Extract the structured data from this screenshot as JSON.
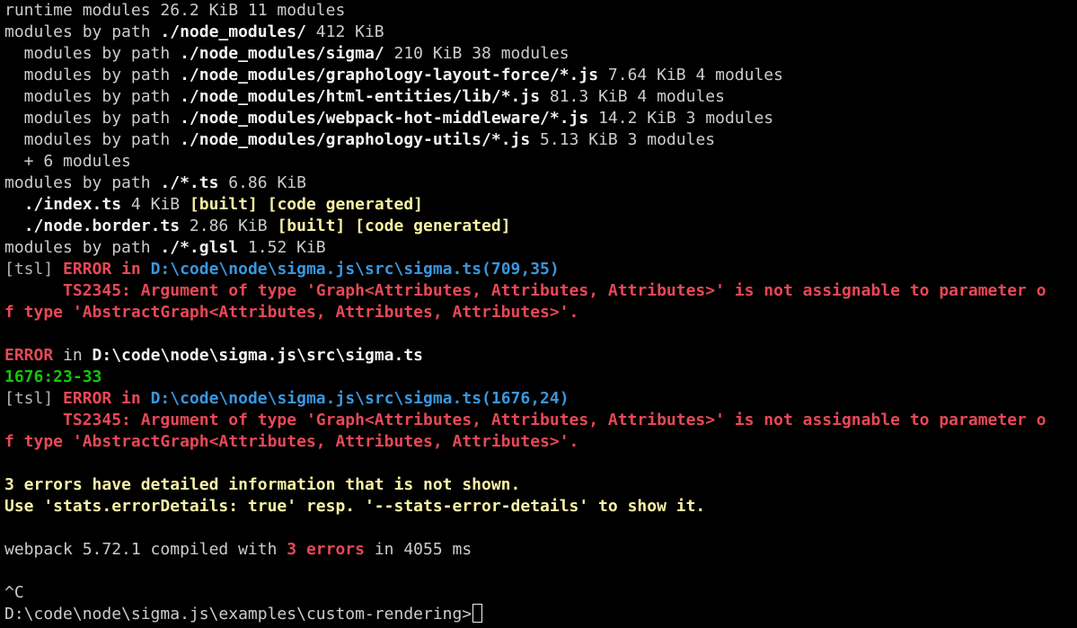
{
  "terminal": {
    "lines": [
      {
        "segments": [
          {
            "text": "runtime modules 26.2 KiB 11 modules",
            "cls": "white"
          }
        ]
      },
      {
        "segments": [
          {
            "text": "modules by path ",
            "cls": "white"
          },
          {
            "text": "./node_modules/",
            "cls": "bright b"
          },
          {
            "text": " 412 KiB",
            "cls": "white"
          }
        ]
      },
      {
        "segments": [
          {
            "text": "  modules by path ",
            "cls": "white"
          },
          {
            "text": "./node_modules/sigma/",
            "cls": "bright b"
          },
          {
            "text": " 210 KiB 38 modules",
            "cls": "white"
          }
        ]
      },
      {
        "segments": [
          {
            "text": "  modules by path ",
            "cls": "white"
          },
          {
            "text": "./node_modules/graphology-layout-force/*.js",
            "cls": "bright b"
          },
          {
            "text": " 7.64 KiB 4 modules",
            "cls": "white"
          }
        ]
      },
      {
        "segments": [
          {
            "text": "  modules by path ",
            "cls": "white"
          },
          {
            "text": "./node_modules/html-entities/lib/*.js",
            "cls": "bright b"
          },
          {
            "text": " 81.3 KiB 4 modules",
            "cls": "white"
          }
        ]
      },
      {
        "segments": [
          {
            "text": "  modules by path ",
            "cls": "white"
          },
          {
            "text": "./node_modules/webpack-hot-middleware/*.js",
            "cls": "bright b"
          },
          {
            "text": " 14.2 KiB 3 modules",
            "cls": "white"
          }
        ]
      },
      {
        "segments": [
          {
            "text": "  modules by path ",
            "cls": "white"
          },
          {
            "text": "./node_modules/graphology-utils/*.js",
            "cls": "bright b"
          },
          {
            "text": " 5.13 KiB 3 modules",
            "cls": "white"
          }
        ]
      },
      {
        "segments": [
          {
            "text": "  + 6 modules",
            "cls": "white"
          }
        ]
      },
      {
        "segments": [
          {
            "text": "modules by path ",
            "cls": "white"
          },
          {
            "text": "./*.ts",
            "cls": "bright b"
          },
          {
            "text": " 6.86 KiB",
            "cls": "white"
          }
        ]
      },
      {
        "segments": [
          {
            "text": "  ",
            "cls": "white"
          },
          {
            "text": "./index.ts",
            "cls": "bright b"
          },
          {
            "text": " 4 KiB ",
            "cls": "white"
          },
          {
            "text": "[built]",
            "cls": "yellow b"
          },
          {
            "text": " ",
            "cls": "white"
          },
          {
            "text": "[code generated]",
            "cls": "yellow b"
          }
        ]
      },
      {
        "segments": [
          {
            "text": "  ",
            "cls": "white"
          },
          {
            "text": "./node.border.ts",
            "cls": "bright b"
          },
          {
            "text": " 2.86 KiB ",
            "cls": "white"
          },
          {
            "text": "[built]",
            "cls": "yellow b"
          },
          {
            "text": " ",
            "cls": "white"
          },
          {
            "text": "[code generated]",
            "cls": "yellow b"
          }
        ]
      },
      {
        "segments": [
          {
            "text": "modules by path ",
            "cls": "white"
          },
          {
            "text": "./*.glsl",
            "cls": "bright b"
          },
          {
            "text": " 1.52 KiB",
            "cls": "white"
          }
        ]
      },
      {
        "segments": [
          {
            "text": "[tsl] ",
            "cls": "gray"
          },
          {
            "text": "ERROR",
            "cls": "red b"
          },
          {
            "text": " in ",
            "cls": "red b"
          },
          {
            "text": "D:\\code\\node\\sigma.js\\src\\sigma.ts(709,35)",
            "cls": "cyan b"
          }
        ]
      },
      {
        "segments": [
          {
            "text": "      TS2345: Argument of type 'Graph<Attributes, Attributes, Attributes>' is not assignable to parameter o",
            "cls": "red b"
          }
        ]
      },
      {
        "segments": [
          {
            "text": "f type 'AbstractGraph<Attributes, Attributes, Attributes>'.",
            "cls": "red b"
          }
        ]
      },
      {
        "segments": [
          {
            "text": "",
            "cls": "white"
          }
        ]
      },
      {
        "segments": [
          {
            "text": "ERROR",
            "cls": "red b"
          },
          {
            "text": " in ",
            "cls": "white"
          },
          {
            "text": "D:\\code\\node\\sigma.js\\src\\sigma.ts",
            "cls": "bright b"
          }
        ]
      },
      {
        "segments": [
          {
            "text": "1676:23-33",
            "cls": "green b"
          }
        ]
      },
      {
        "segments": [
          {
            "text": "[tsl] ",
            "cls": "gray"
          },
          {
            "text": "ERROR",
            "cls": "red b"
          },
          {
            "text": " in ",
            "cls": "red b"
          },
          {
            "text": "D:\\code\\node\\sigma.js\\src\\sigma.ts(1676,24)",
            "cls": "cyan b"
          }
        ]
      },
      {
        "segments": [
          {
            "text": "      TS2345: Argument of type 'Graph<Attributes, Attributes, Attributes>' is not assignable to parameter o",
            "cls": "red b"
          }
        ]
      },
      {
        "segments": [
          {
            "text": "f type 'AbstractGraph<Attributes, Attributes, Attributes>'.",
            "cls": "red b"
          }
        ]
      },
      {
        "segments": [
          {
            "text": "",
            "cls": "white"
          }
        ]
      },
      {
        "segments": [
          {
            "text": "3 errors have detailed information that is not shown.",
            "cls": "yellow b"
          }
        ]
      },
      {
        "segments": [
          {
            "text": "Use 'stats.errorDetails: true' resp. '--stats-error-details' to show it.",
            "cls": "yellow b"
          }
        ]
      },
      {
        "segments": [
          {
            "text": "",
            "cls": "white"
          }
        ]
      },
      {
        "segments": [
          {
            "text": "webpack 5.72.1 compiled with ",
            "cls": "white"
          },
          {
            "text": "3 errors",
            "cls": "red b"
          },
          {
            "text": " in 4055 ms",
            "cls": "white"
          }
        ]
      },
      {
        "segments": [
          {
            "text": "",
            "cls": "white"
          }
        ]
      },
      {
        "segments": [
          {
            "text": "^C",
            "cls": "white"
          }
        ]
      }
    ],
    "prompt": "D:\\code\\node\\sigma.js\\examples\\custom-rendering>",
    "input_value": ""
  }
}
